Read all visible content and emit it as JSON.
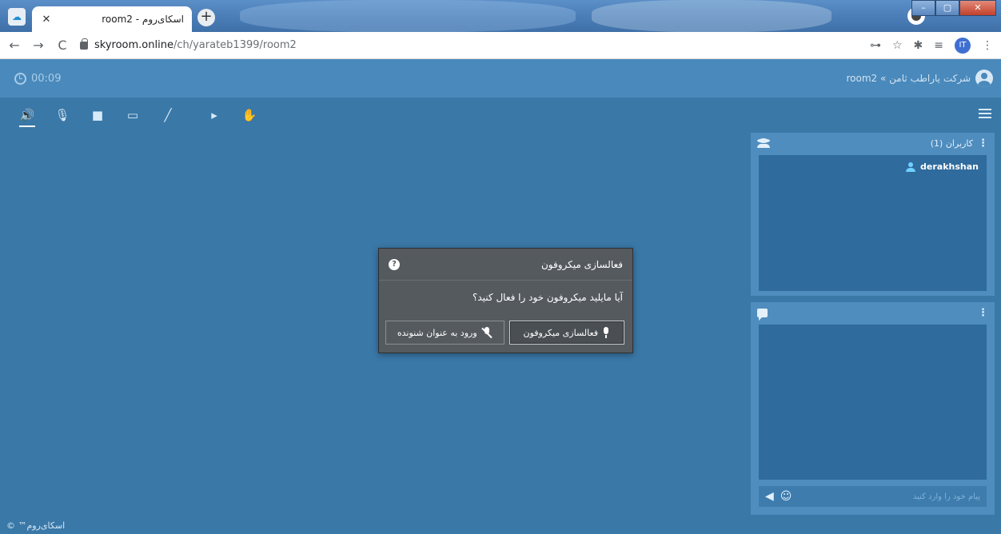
{
  "browser": {
    "tab_title": "اسکای‌روم - room2",
    "tab_close": "✕",
    "new_tab": "+",
    "url_host": "skyroom.online",
    "url_path": "/ch/yarateb1399/room2",
    "profile_initials": "IT",
    "window_controls": {
      "minimize": "–",
      "maximize": "▢",
      "close": "✕"
    },
    "nav": {
      "back": "←",
      "forward": "→",
      "reload": "C"
    },
    "toolbar_icons": {
      "key": "⊶",
      "star": "☆",
      "puzzle": "✱",
      "playlist": "≡",
      "more": "⋮"
    }
  },
  "header": {
    "timer": "00:09",
    "room_title": "شرکت یاراطب ثامن » room2"
  },
  "controls": {
    "icons": [
      "speaker-icon",
      "mic-off-icon",
      "camera-icon",
      "screen-share-icon",
      "brush-icon",
      "play-icon",
      "raise-hand-icon"
    ],
    "glyphs": {
      "speaker": "🔊",
      "mic_off": "🎙",
      "camera": "■",
      "screen": "▭",
      "brush": "╱",
      "play": "▸",
      "hand": "✋"
    }
  },
  "users_panel": {
    "title": "کاربران (1)",
    "users": [
      {
        "name": "derakhshan"
      }
    ]
  },
  "chat_panel": {
    "placeholder": "پیام خود را وارد کنید",
    "send_glyph": "◀",
    "emoji_glyph": "☺"
  },
  "modal": {
    "title": "فعالسازی میکروفون",
    "help": "?",
    "question": "آیا مایلید میکروفون خود را فعال کنید؟",
    "enable_button": "فعالسازی میکروفون",
    "listener_button": "ورود به عنوان شنونده"
  },
  "footer": {
    "text": "اسکای‌روم™ ©"
  },
  "colors": {
    "app_bg": "#3a78a8",
    "header_bg": "#4a89bb",
    "panel_bg": "#4f8dbf",
    "panel_body": "#2f6b9c",
    "modal_bg": "#555a5f"
  }
}
